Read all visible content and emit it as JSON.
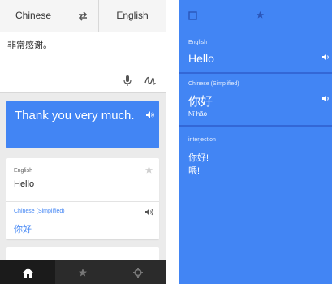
{
  "left": {
    "source_lang": "Chinese",
    "target_lang": "English",
    "input_text": "非常感谢。",
    "result_text": "Thank you very much.",
    "dict": {
      "label1": "English",
      "word1": "Hello",
      "label2": "Chinese (Simplified)",
      "word2": "你好"
    }
  },
  "right": {
    "label1": "English",
    "word1": "Hello",
    "label2": "Chinese (Simplified)",
    "word2": "你好",
    "pinyin": "Nǐ hǎo",
    "pos": "interjection",
    "entry1": "你好!",
    "entry2": "喂!"
  },
  "colors": {
    "accent": "#4285f4",
    "accent_dark": "#3367d6",
    "tabbar": "#2b2b2b"
  }
}
